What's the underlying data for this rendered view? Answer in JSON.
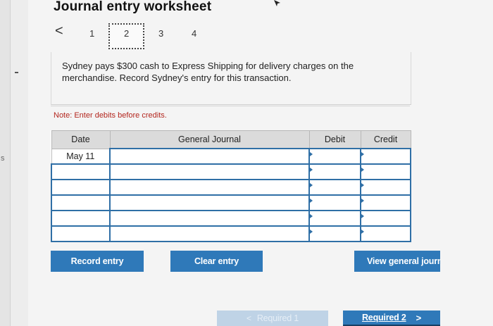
{
  "header": {
    "title": "Journal entry worksheet"
  },
  "pager": {
    "prev_icon": "chevron-left-icon",
    "prev_glyph": "<",
    "pages": [
      "1",
      "2",
      "3",
      "4"
    ],
    "current": "2"
  },
  "instructions": "Sydney pays $300 cash to Express Shipping for delivery charges on the merchandise. Record Sydney's entry for this transaction.",
  "note": "Note: Enter debits before credits.",
  "journal": {
    "headers": {
      "date": "Date",
      "account": "General Journal",
      "debit": "Debit",
      "credit": "Credit"
    },
    "rows": [
      {
        "date": "May 11",
        "account": "",
        "debit": "",
        "credit": ""
      },
      {
        "date": "",
        "account": "",
        "debit": "",
        "credit": ""
      },
      {
        "date": "",
        "account": "",
        "debit": "",
        "credit": ""
      },
      {
        "date": "",
        "account": "",
        "debit": "",
        "credit": ""
      },
      {
        "date": "",
        "account": "",
        "debit": "",
        "credit": ""
      },
      {
        "date": "",
        "account": "",
        "debit": "",
        "credit": ""
      }
    ]
  },
  "buttons": {
    "record": "Record entry",
    "clear": "Clear entry",
    "view": "View general journ",
    "prev_required": "Required 1",
    "next_required": "Required 2",
    "prev_glyph": "<",
    "next_glyph": ">"
  },
  "sidebar": {
    "edge_label": "s"
  },
  "colors": {
    "button": "#2f79b9",
    "note": "#b3261e",
    "input_border": "#2f6fa6"
  }
}
